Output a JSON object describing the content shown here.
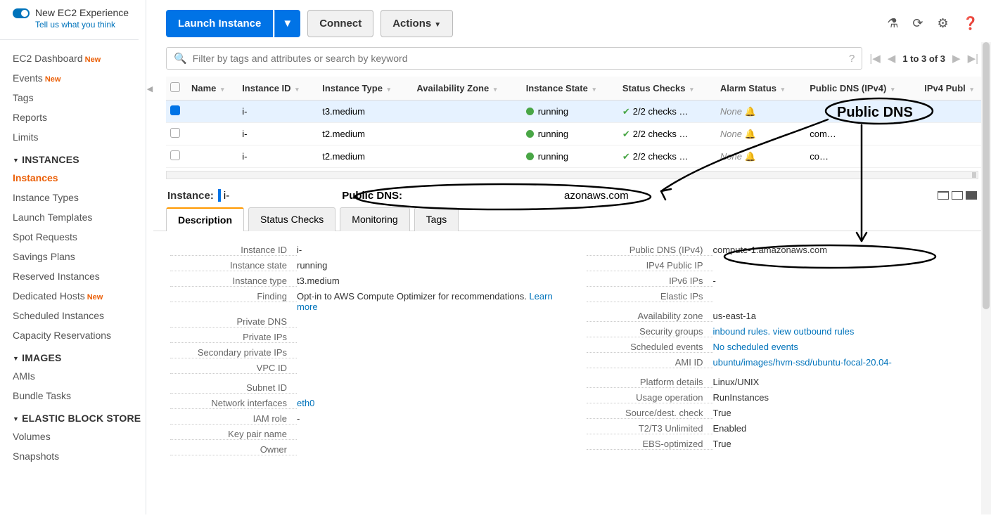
{
  "sidebar": {
    "new_exp": "New EC2 Experience",
    "new_exp_sub": "Tell us what you think",
    "items_top": [
      {
        "label": "EC2 Dashboard",
        "new": true
      },
      {
        "label": "Events",
        "new": true
      },
      {
        "label": "Tags",
        "new": false
      },
      {
        "label": "Reports",
        "new": false
      },
      {
        "label": "Limits",
        "new": false
      }
    ],
    "sec_instances": "INSTANCES",
    "items_instances": [
      {
        "label": "Instances",
        "active": true
      },
      {
        "label": "Instance Types"
      },
      {
        "label": "Launch Templates"
      },
      {
        "label": "Spot Requests"
      },
      {
        "label": "Savings Plans"
      },
      {
        "label": "Reserved Instances"
      },
      {
        "label": "Dedicated Hosts",
        "new": true
      },
      {
        "label": "Scheduled Instances"
      },
      {
        "label": "Capacity Reservations"
      }
    ],
    "sec_images": "IMAGES",
    "items_images": [
      {
        "label": "AMIs"
      },
      {
        "label": "Bundle Tasks"
      }
    ],
    "sec_ebs": "ELASTIC BLOCK STORE",
    "items_ebs": [
      {
        "label": "Volumes"
      },
      {
        "label": "Snapshots"
      }
    ]
  },
  "toolbar": {
    "launch": "Launch Instance",
    "connect": "Connect",
    "actions": "Actions"
  },
  "search": {
    "placeholder": "Filter by tags and attributes or search by keyword"
  },
  "pager": {
    "text": "1 to 3 of 3"
  },
  "table": {
    "cols": [
      "Name",
      "Instance ID",
      "Instance Type",
      "Availability Zone",
      "Instance State",
      "Status Checks",
      "Alarm Status",
      "Public DNS (IPv4)",
      "IPv4 Publ"
    ],
    "rows": [
      {
        "sel": true,
        "name": "",
        "id": "i-",
        "type": "t3.medium",
        "az": "",
        "state": "running",
        "checks": "2/2 checks …",
        "alarm": "None",
        "dns": ""
      },
      {
        "sel": false,
        "name": "",
        "id": "i-",
        "type": "t2.medium",
        "az": "",
        "state": "running",
        "checks": "2/2 checks …",
        "alarm": "None",
        "dns": "com…"
      },
      {
        "sel": false,
        "name": "",
        "id": "i-",
        "type": "t2.medium",
        "az": "",
        "state": "running",
        "checks": "2/2 checks …",
        "alarm": "None",
        "dns": "co…"
      }
    ]
  },
  "detail": {
    "instance_lbl": "Instance:",
    "instance_id": "i-",
    "pubdns_lbl": "Public DNS:",
    "pubdns": "azonaws.com"
  },
  "tabs": [
    "Description",
    "Status Checks",
    "Monitoring",
    "Tags"
  ],
  "desc": {
    "left": [
      {
        "k": "Instance ID",
        "v": "i-"
      },
      {
        "k": "Instance state",
        "v": "running"
      },
      {
        "k": "Instance type",
        "v": "t3.medium"
      },
      {
        "k": "Finding",
        "v": "Opt-in to AWS Compute Optimizer for recommendations.",
        "link": "Learn more"
      },
      {
        "k": "Private DNS",
        "v": ""
      },
      {
        "k": "Private IPs",
        "v": ""
      },
      {
        "k": "Secondary private IPs",
        "v": ""
      },
      {
        "k": "VPC ID",
        "v": ""
      },
      {
        "k": "",
        "v": ""
      },
      {
        "k": "Subnet ID",
        "v": ""
      },
      {
        "k": "Network interfaces",
        "v": "",
        "link": "eth0"
      },
      {
        "k": "IAM role",
        "v": "-"
      },
      {
        "k": "Key pair name",
        "v": ""
      },
      {
        "k": "Owner",
        "v": ""
      }
    ],
    "right": [
      {
        "k": "Public DNS (IPv4)",
        "v": "compute-1.amazonaws.com"
      },
      {
        "k": "IPv4 Public IP",
        "v": ""
      },
      {
        "k": "IPv6 IPs",
        "v": "-"
      },
      {
        "k": "Elastic IPs",
        "v": ""
      },
      {
        "k": "",
        "v": ""
      },
      {
        "k": "Availability zone",
        "v": "us-east-1a"
      },
      {
        "k": "Security groups",
        "v": "",
        "link": "inbound rules. view outbound rules"
      },
      {
        "k": "Scheduled events",
        "v": "",
        "link": "No scheduled events"
      },
      {
        "k": "AMI ID",
        "v": "",
        "link": "ubuntu/images/hvm-ssd/ubuntu-focal-20.04-"
      },
      {
        "k": "",
        "v": ""
      },
      {
        "k": "Platform details",
        "v": "Linux/UNIX"
      },
      {
        "k": "Usage operation",
        "v": "RunInstances"
      },
      {
        "k": "Source/dest. check",
        "v": "True"
      },
      {
        "k": "T2/T3 Unlimited",
        "v": "Enabled"
      },
      {
        "k": "EBS-optimized",
        "v": "True"
      }
    ]
  },
  "annotation_label": "Public DNS"
}
